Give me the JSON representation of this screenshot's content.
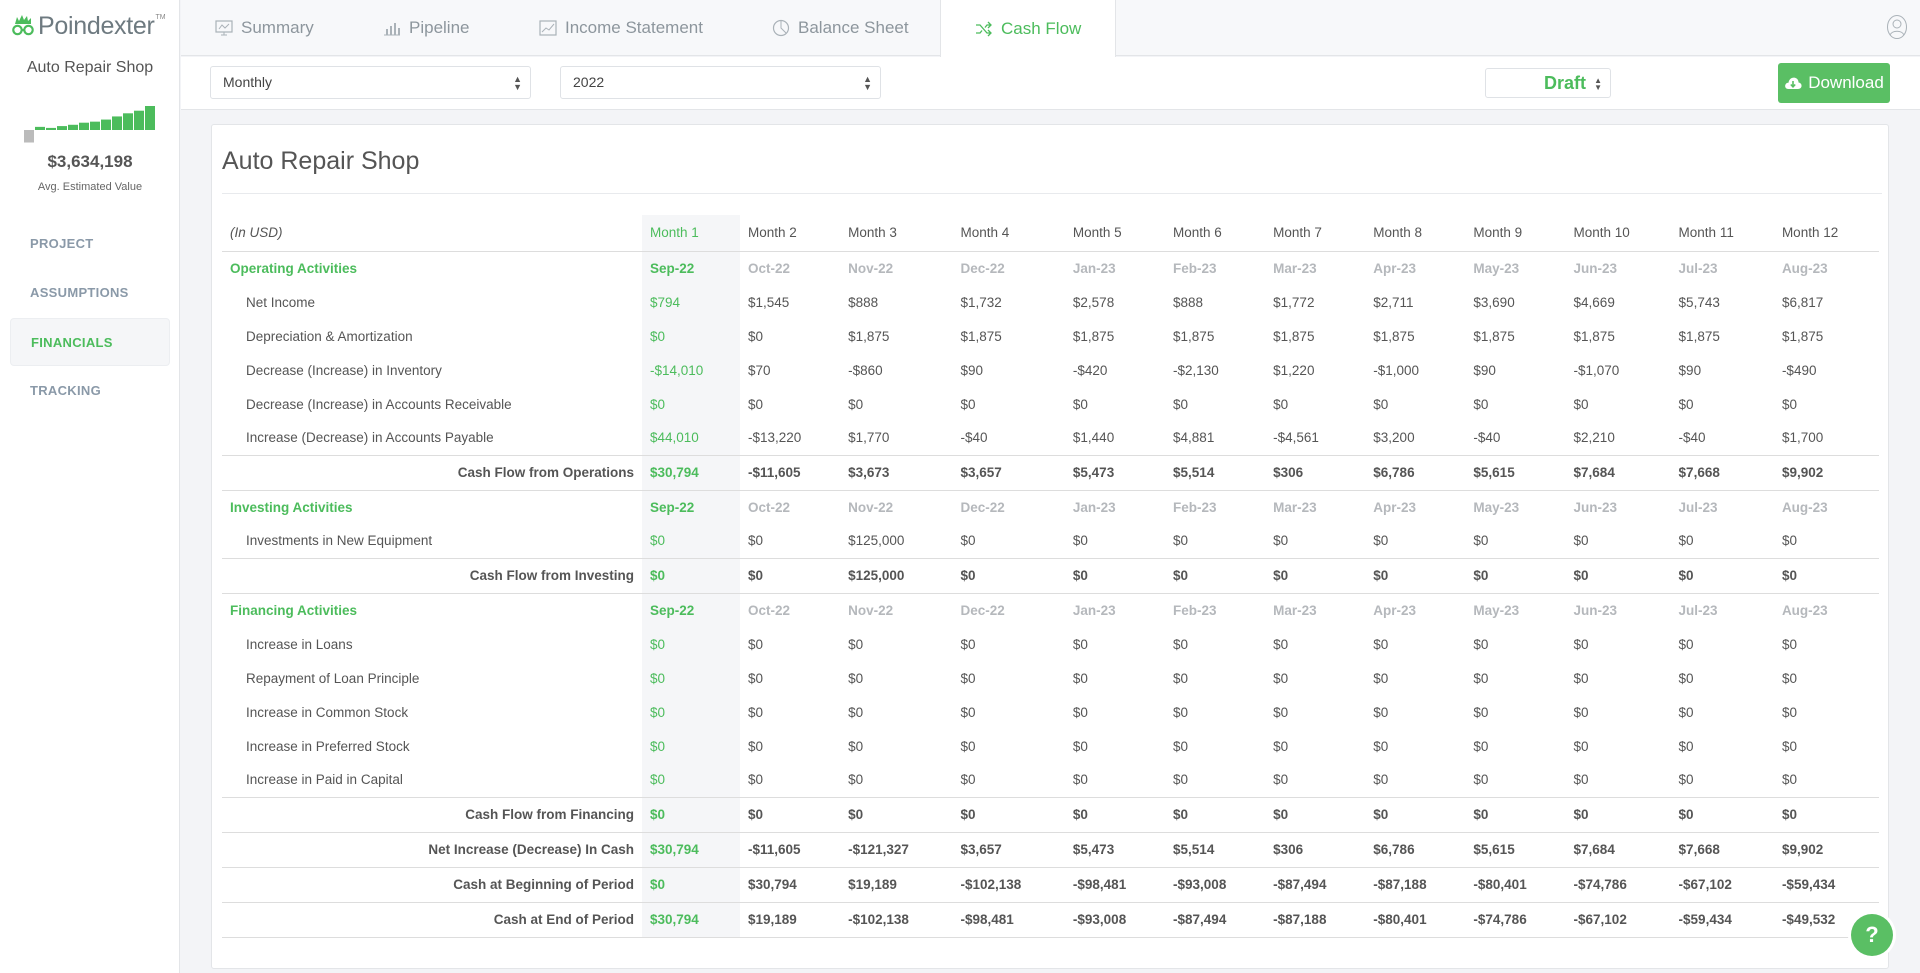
{
  "app": {
    "brand": "Poindexter",
    "brand_tm": "TM",
    "accent_color": "#4cbc5c"
  },
  "sidebar": {
    "project_name": "Auto Repair Shop",
    "sparkline_values": [
      -3,
      1.2,
      0.8,
      1.5,
      2,
      2.8,
      3.2,
      4,
      5.2,
      6.4,
      7.4,
      9.2
    ],
    "estimated_value": "$3,634,198",
    "estimated_label": "Avg. Estimated Value",
    "items": [
      {
        "label": "PROJECT",
        "active": false
      },
      {
        "label": "ASSUMPTIONS",
        "active": false
      },
      {
        "label": "FINANCIALS",
        "active": true
      },
      {
        "label": "TRACKING",
        "active": false
      }
    ]
  },
  "tabs": [
    {
      "label": "Summary",
      "icon": "presentation-icon",
      "active": false
    },
    {
      "label": "Pipeline",
      "icon": "bar-chart-icon",
      "active": false
    },
    {
      "label": "Income Statement",
      "icon": "line-chart-icon",
      "active": false
    },
    {
      "label": "Balance Sheet",
      "icon": "pie-chart-icon",
      "active": false
    },
    {
      "label": "Cash Flow",
      "icon": "shuffle-icon",
      "active": true
    }
  ],
  "controls": {
    "period_select": "Monthly",
    "year_select": "2022",
    "status_select": "Draft",
    "download_label": "Download"
  },
  "report": {
    "title": "Auto Repair Shop",
    "unit_label": "(In USD)",
    "months": [
      "Month 1",
      "Month 2",
      "Month 3",
      "Month 4",
      "Month 5",
      "Month 6",
      "Month 7",
      "Month 8",
      "Month 9",
      "Month 10",
      "Month 11",
      "Month 12"
    ],
    "dates": [
      "Sep-22",
      "Oct-22",
      "Nov-22",
      "Dec-22",
      "Jan-23",
      "Feb-23",
      "Mar-23",
      "Apr-23",
      "May-23",
      "Jun-23",
      "Jul-23",
      "Aug-23"
    ],
    "sections": [
      {
        "title": "Operating Activities",
        "rows": [
          {
            "label": "Net Income",
            "values": [
              "$794",
              "$1,545",
              "$888",
              "$1,732",
              "$2,578",
              "$888",
              "$1,772",
              "$2,711",
              "$3,690",
              "$4,669",
              "$5,743",
              "$6,817"
            ]
          },
          {
            "label": "Depreciation & Amortization",
            "values": [
              "$0",
              "$0",
              "$1,875",
              "$1,875",
              "$1,875",
              "$1,875",
              "$1,875",
              "$1,875",
              "$1,875",
              "$1,875",
              "$1,875",
              "$1,875"
            ]
          },
          {
            "label": "Decrease (Increase) in Inventory",
            "values": [
              "-$14,010",
              "$70",
              "-$860",
              "$90",
              "-$420",
              "-$2,130",
              "$1,220",
              "-$1,000",
              "$90",
              "-$1,070",
              "$90",
              "-$490"
            ]
          },
          {
            "label": "Decrease (Increase) in Accounts Receivable",
            "values": [
              "$0",
              "$0",
              "$0",
              "$0",
              "$0",
              "$0",
              "$0",
              "$0",
              "$0",
              "$0",
              "$0",
              "$0"
            ]
          },
          {
            "label": "Increase (Decrease) in Accounts Payable",
            "values": [
              "$44,010",
              "-$13,220",
              "$1,770",
              "-$40",
              "$1,440",
              "$4,881",
              "-$4,561",
              "$3,200",
              "-$40",
              "$2,210",
              "-$40",
              "$1,700"
            ]
          }
        ],
        "total": {
          "label": "Cash Flow from Operations",
          "values": [
            "$30,794",
            "-$11,605",
            "$3,673",
            "$3,657",
            "$5,473",
            "$5,514",
            "$306",
            "$6,786",
            "$5,615",
            "$7,684",
            "$7,668",
            "$9,902"
          ]
        }
      },
      {
        "title": "Investing Activities",
        "rows": [
          {
            "label": "Investments in New Equipment",
            "values": [
              "$0",
              "$0",
              "$125,000",
              "$0",
              "$0",
              "$0",
              "$0",
              "$0",
              "$0",
              "$0",
              "$0",
              "$0"
            ]
          }
        ],
        "total": {
          "label": "Cash Flow from Investing",
          "values": [
            "$0",
            "$0",
            "$125,000",
            "$0",
            "$0",
            "$0",
            "$0",
            "$0",
            "$0",
            "$0",
            "$0",
            "$0"
          ]
        }
      },
      {
        "title": "Financing Activities",
        "rows": [
          {
            "label": "Increase in Loans",
            "values": [
              "$0",
              "$0",
              "$0",
              "$0",
              "$0",
              "$0",
              "$0",
              "$0",
              "$0",
              "$0",
              "$0",
              "$0"
            ]
          },
          {
            "label": "Repayment of Loan Principle",
            "values": [
              "$0",
              "$0",
              "$0",
              "$0",
              "$0",
              "$0",
              "$0",
              "$0",
              "$0",
              "$0",
              "$0",
              "$0"
            ]
          },
          {
            "label": "Increase in Common Stock",
            "values": [
              "$0",
              "$0",
              "$0",
              "$0",
              "$0",
              "$0",
              "$0",
              "$0",
              "$0",
              "$0",
              "$0",
              "$0"
            ]
          },
          {
            "label": "Increase in Preferred Stock",
            "values": [
              "$0",
              "$0",
              "$0",
              "$0",
              "$0",
              "$0",
              "$0",
              "$0",
              "$0",
              "$0",
              "$0",
              "$0"
            ]
          },
          {
            "label": "Increase in Paid in Capital",
            "values": [
              "$0",
              "$0",
              "$0",
              "$0",
              "$0",
              "$0",
              "$0",
              "$0",
              "$0",
              "$0",
              "$0",
              "$0"
            ]
          }
        ],
        "total": {
          "label": "Cash Flow from Financing",
          "values": [
            "$0",
            "$0",
            "$0",
            "$0",
            "$0",
            "$0",
            "$0",
            "$0",
            "$0",
            "$0",
            "$0",
            "$0"
          ]
        }
      }
    ],
    "summary": [
      {
        "label": "Net Increase (Decrease) In Cash",
        "values": [
          "$30,794",
          "-$11,605",
          "-$121,327",
          "$3,657",
          "$5,473",
          "$5,514",
          "$306",
          "$6,786",
          "$5,615",
          "$7,684",
          "$7,668",
          "$9,902"
        ]
      },
      {
        "label": "Cash at Beginning of Period",
        "values": [
          "$0",
          "$30,794",
          "$19,189",
          "-$102,138",
          "-$98,481",
          "-$93,008",
          "-$87,494",
          "-$87,188",
          "-$80,401",
          "-$74,786",
          "-$67,102",
          "-$59,434"
        ]
      },
      {
        "label": "Cash at End of Period",
        "values": [
          "$30,794",
          "$19,189",
          "-$102,138",
          "-$98,481",
          "-$93,008",
          "-$87,494",
          "-$87,188",
          "-$80,401",
          "-$74,786",
          "-$67,102",
          "-$59,434",
          "-$49,532"
        ]
      }
    ]
  },
  "help": {
    "label": "?"
  }
}
